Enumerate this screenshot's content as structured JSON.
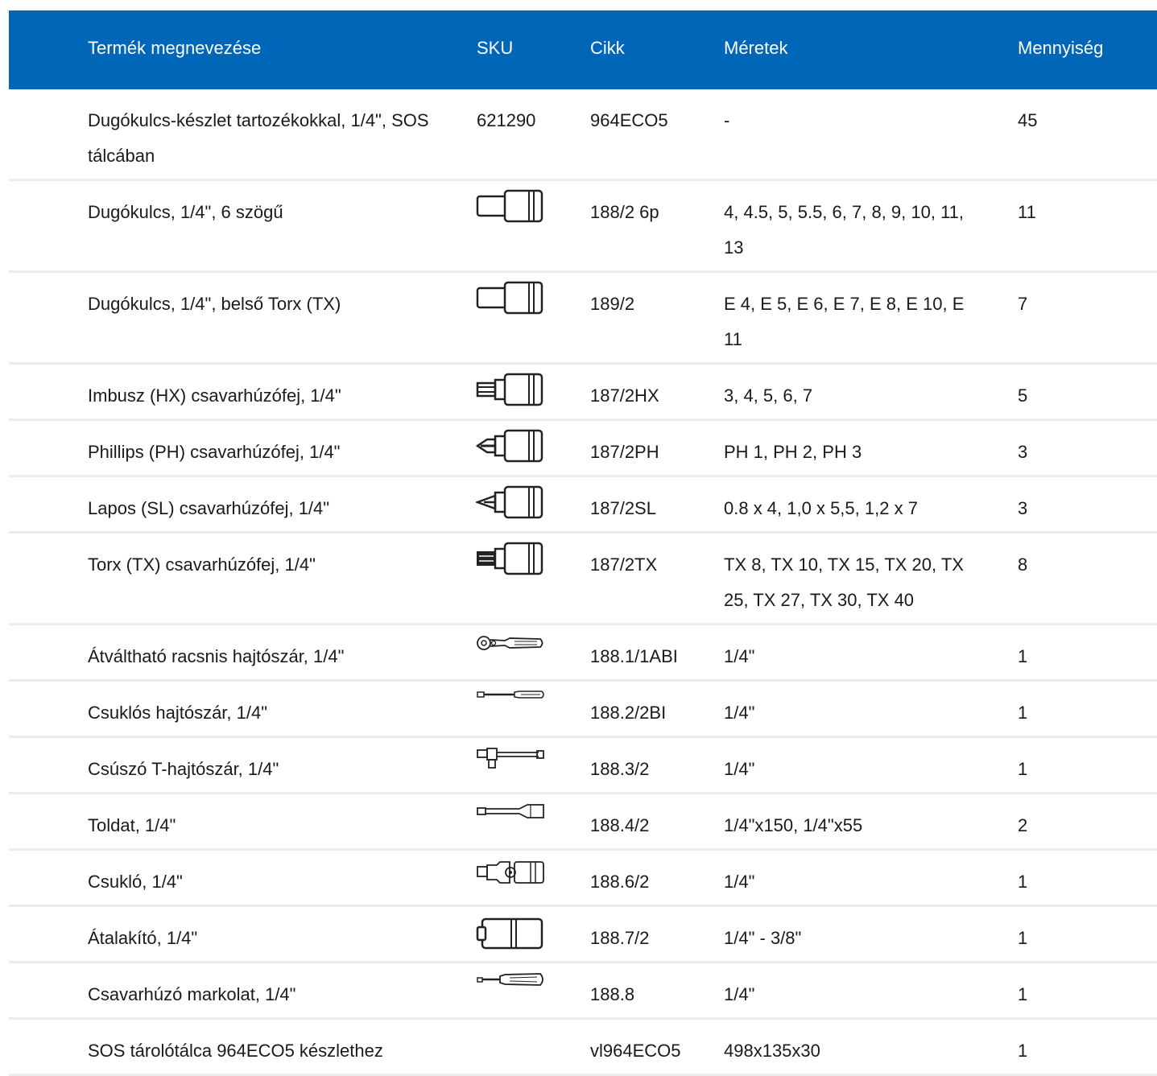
{
  "headers": {
    "name": "Termék megnevezése",
    "sku": "SKU",
    "cikk": "Cikk",
    "dim": "Méretek",
    "qty": "Mennyiség"
  },
  "rows": [
    {
      "name": "Dugókulcs-készlet tartozékokkal, 1/4\", SOS tálcában",
      "sku": "621290",
      "cikk": "964ECO5",
      "dim": "-",
      "qty": "45",
      "icon": ""
    },
    {
      "name": "Dugókulcs, 1/4\", 6 szögű",
      "sku": "",
      "cikk": "188/2 6p",
      "dim": "4, 4.5, 5, 5.5, 6, 7, 8, 9, 10, 11, 13",
      "qty": "11",
      "icon": "socket-icon"
    },
    {
      "name": "Dugókulcs, 1/4\", belső Torx (TX)",
      "sku": "",
      "cikk": "189/2",
      "dim": "E 4, E 5, E 6, E 7, E 8, E 10, E 11",
      "qty": "7",
      "icon": "socket-icon"
    },
    {
      "name": "Imbusz (HX) csavarhúzófej, 1/4\"",
      "sku": "",
      "cikk": "187/2HX",
      "dim": "3, 4, 5, 6, 7",
      "qty": "5",
      "icon": "hex-bit-socket-icon"
    },
    {
      "name": "Phillips (PH) csavarhúzófej, 1/4\"",
      "sku": "",
      "cikk": "187/2PH",
      "dim": "PH 1, PH 2, PH 3",
      "qty": "3",
      "icon": "phillips-bit-socket-icon"
    },
    {
      "name": "Lapos (SL) csavarhúzófej, 1/4\"",
      "sku": "",
      "cikk": "187/2SL",
      "dim": "0.8 x 4, 1,0 x 5,5, 1,2 x 7",
      "qty": "3",
      "icon": "slotted-bit-socket-icon"
    },
    {
      "name": "Torx (TX) csavarhúzófej, 1/4\"",
      "sku": "",
      "cikk": "187/2TX",
      "dim": "TX 8, TX 10, TX 15, TX 20, TX 25, TX 27, TX 30, TX 40",
      "qty": "8",
      "icon": "torx-bit-socket-icon"
    },
    {
      "name": "Átváltható racsnis hajtószár, 1/4\"",
      "sku": "",
      "cikk": "188.1/1ABI",
      "dim": "1/4\"",
      "qty": "1",
      "icon": "ratchet-icon"
    },
    {
      "name": "Csuklós hajtószár, 1/4\"",
      "sku": "",
      "cikk": "188.2/2BI",
      "dim": "1/4\"",
      "qty": "1",
      "icon": "hinged-handle-icon"
    },
    {
      "name": "Csúszó T-hajtószár, 1/4\"",
      "sku": "",
      "cikk": "188.3/2",
      "dim": "1/4\"",
      "qty": "1",
      "icon": "t-handle-icon"
    },
    {
      "name": "Toldat, 1/4\"",
      "sku": "",
      "cikk": "188.4/2",
      "dim": "1/4\"x150, 1/4\"x55",
      "qty": "2",
      "icon": "extension-bar-icon"
    },
    {
      "name": "Csukló, 1/4\"",
      "sku": "",
      "cikk": "188.6/2",
      "dim": "1/4\"",
      "qty": "1",
      "icon": "universal-joint-icon"
    },
    {
      "name": "Átalakító, 1/4\"",
      "sku": "",
      "cikk": "188.7/2",
      "dim": "1/4\" - 3/8\"",
      "qty": "1",
      "icon": "adapter-icon"
    },
    {
      "name": "Csavarhúzó markolat, 1/4\"",
      "sku": "",
      "cikk": "188.8",
      "dim": "1/4\"",
      "qty": "1",
      "icon": "screwdriver-handle-icon"
    },
    {
      "name": "SOS tárolótálca 964ECO5 készlethez",
      "sku": "",
      "cikk": "vl964ECO5",
      "dim": "498x135x30",
      "qty": "1",
      "icon": ""
    }
  ]
}
